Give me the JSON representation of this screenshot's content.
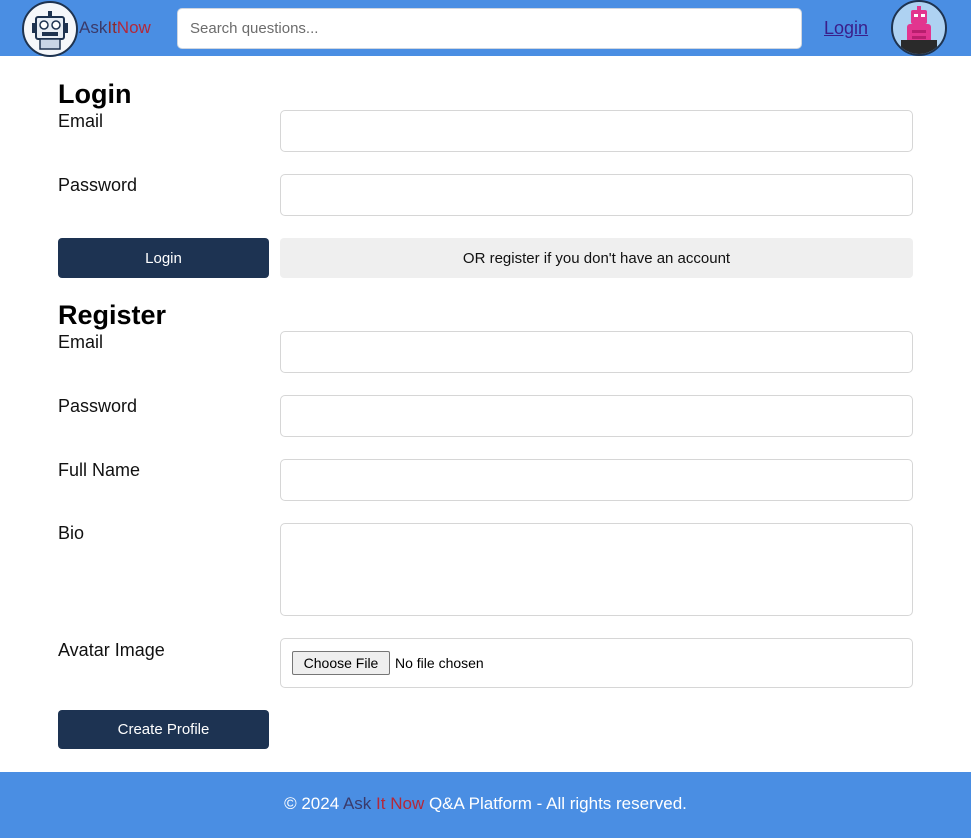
{
  "header": {
    "brand_ask": "Ask",
    "brand_it": "It",
    "brand_now": "Now",
    "search_placeholder": "Search questions...",
    "login_link": "Login",
    "logo_icon": "robot-logo-icon",
    "avatar_icon": "pink-robot-avatar"
  },
  "login": {
    "title": "Login",
    "email_label": "Email",
    "password_label": "Password",
    "submit_label": "Login",
    "register_hint": "OR register if you don't have an account"
  },
  "register": {
    "title": "Register",
    "email_label": "Email",
    "password_label": "Password",
    "fullname_label": "Full Name",
    "bio_label": "Bio",
    "avatar_label": "Avatar Image",
    "file_button": "Choose File",
    "file_status": "No file chosen",
    "submit_label": "Create Profile"
  },
  "footer": {
    "prefix": "© 2024 ",
    "brand_ask": "Ask",
    "brand_it": "It",
    "brand_now": "Now",
    "suffix": " Q&A Platform - All rights reserved."
  },
  "colors": {
    "header_bg": "#4a8ee3",
    "primary_button": "#1d3352",
    "secondary_button": "#efefef",
    "brand_red": "#b3283a"
  }
}
